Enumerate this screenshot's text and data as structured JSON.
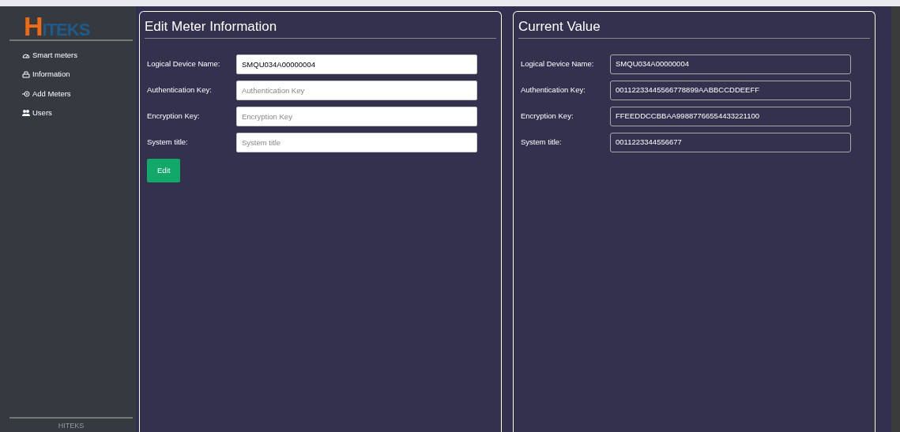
{
  "sidebar": {
    "logo": {
      "initial": "H",
      "rest": "ITEKS"
    },
    "items": [
      {
        "label": "Smart meters"
      },
      {
        "label": "Information"
      },
      {
        "label": "Add Meters"
      },
      {
        "label": "Users"
      }
    ],
    "footer": "HITEKS"
  },
  "edit_panel": {
    "title": "Edit Meter Information",
    "fields": [
      {
        "label": "Logical Device Name:",
        "value": "SMQU034A00000004"
      },
      {
        "label": "Authentication Key:",
        "placeholder": "Authentication Key"
      },
      {
        "label": "Encryption Key:",
        "placeholder": "Encryption Key"
      },
      {
        "label": "System title:",
        "placeholder": "System title"
      }
    ],
    "button": "Edit"
  },
  "current_panel": {
    "title": "Current Value",
    "fields": [
      {
        "label": "Logical Device Name:",
        "value": "SMQU034A00000004"
      },
      {
        "label": "Authentication Key:",
        "value": "00112233445566778899AABBCCDDEEFF"
      },
      {
        "label": "Encryption Key:",
        "value": "FFEEDDCCBBAA99887766554433221100"
      },
      {
        "label": "System title:",
        "value": "0011223344556677"
      }
    ]
  }
}
